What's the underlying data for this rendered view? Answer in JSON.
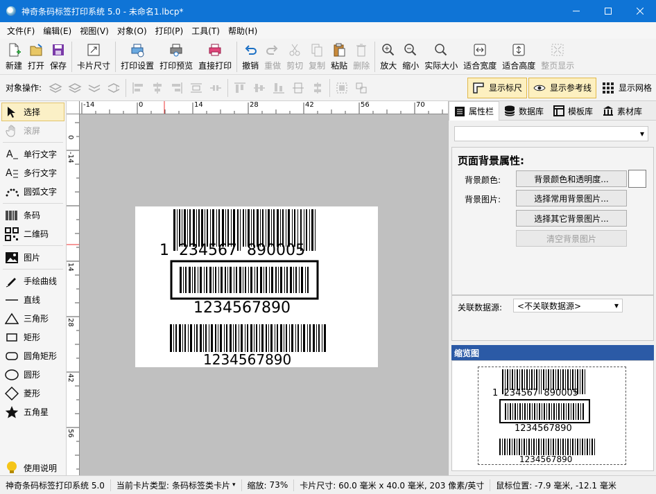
{
  "window": {
    "title": "神奇条码标签打印系统 5.0 - 未命名1.lbcp*"
  },
  "menu": [
    "文件(F)",
    "编辑(E)",
    "视图(V)",
    "对象(O)",
    "打印(P)",
    "工具(T)",
    "帮助(H)"
  ],
  "toolbar": {
    "new": "新建",
    "open": "打开",
    "save": "保存",
    "card_size": "卡片尺寸",
    "print_setup": "打印设置",
    "print_preview": "打印预览",
    "direct_print": "直接打印",
    "undo": "撤销",
    "redo": "重做",
    "cut": "剪切",
    "copy": "复制",
    "paste": "粘贴",
    "delete": "删除",
    "zoom_in": "放大",
    "zoom_out": "缩小",
    "actual_size": "实际大小",
    "fit_width": "适合宽度",
    "fit_height": "适合高度",
    "full_page": "整页显示"
  },
  "objbar": {
    "label": "对象操作:",
    "show_ruler": "显示标尺",
    "show_guides": "显示参考线",
    "show_grid": "显示网格"
  },
  "tools": {
    "select": "选择",
    "scroll": "滚屏",
    "single_text": "单行文字",
    "multi_text": "多行文字",
    "arc_text": "圆弧文字",
    "barcode": "条码",
    "qrcode": "二维码",
    "image": "图片",
    "freehand": "手绘曲线",
    "line": "直线",
    "triangle": "三角形",
    "rectangle": "矩形",
    "rounded_rect": "圆角矩形",
    "circle": "圆形",
    "diamond": "菱形",
    "star": "五角星",
    "help": "使用说明"
  },
  "ruler": {
    "h_ticks": [
      "-14",
      "0",
      "14",
      "28",
      "42",
      "56",
      "70"
    ],
    "v_ticks": [
      "0",
      "-14",
      "14",
      "28",
      "42",
      "56"
    ]
  },
  "label": {
    "barcode1_text": "1  234567  890005",
    "barcode2_text": "1234567890",
    "barcode3_text": "1234567890"
  },
  "panel": {
    "tabs": [
      "属性栏",
      "数据库",
      "模板库",
      "素材库"
    ],
    "section_title": "页面背景属性:",
    "bg_color_label": "背景颜色:",
    "bg_color_btn": "背景颜色和透明度...",
    "bg_image_label": "背景图片:",
    "bg_common_btn": "选择常用背景图片...",
    "bg_other_btn": "选择其它背景图片...",
    "bg_clear_btn": "清空背景图片",
    "datasource_label": "关联数据源:",
    "datasource_value": "<不关联数据源>",
    "overview_title": "缩览图"
  },
  "status": {
    "app": "神奇条码标签打印系统 5.0",
    "card_type_label": "当前卡片类型:",
    "card_type": "条码标签类卡片",
    "zoom_label": "缩放:",
    "zoom": "73%",
    "card_size": "卡片尺寸: 60.0 毫米 x 40.0 毫米, 203 像素/英寸",
    "mouse": "鼠标位置: -7.9 毫米, -12.1 毫米"
  },
  "colors": {
    "titlebar": "#0f74d6",
    "canvas_bg": "#c0c0c0",
    "overview_head": "#2b5aa6",
    "toggle_on": "#fdf0c0"
  }
}
